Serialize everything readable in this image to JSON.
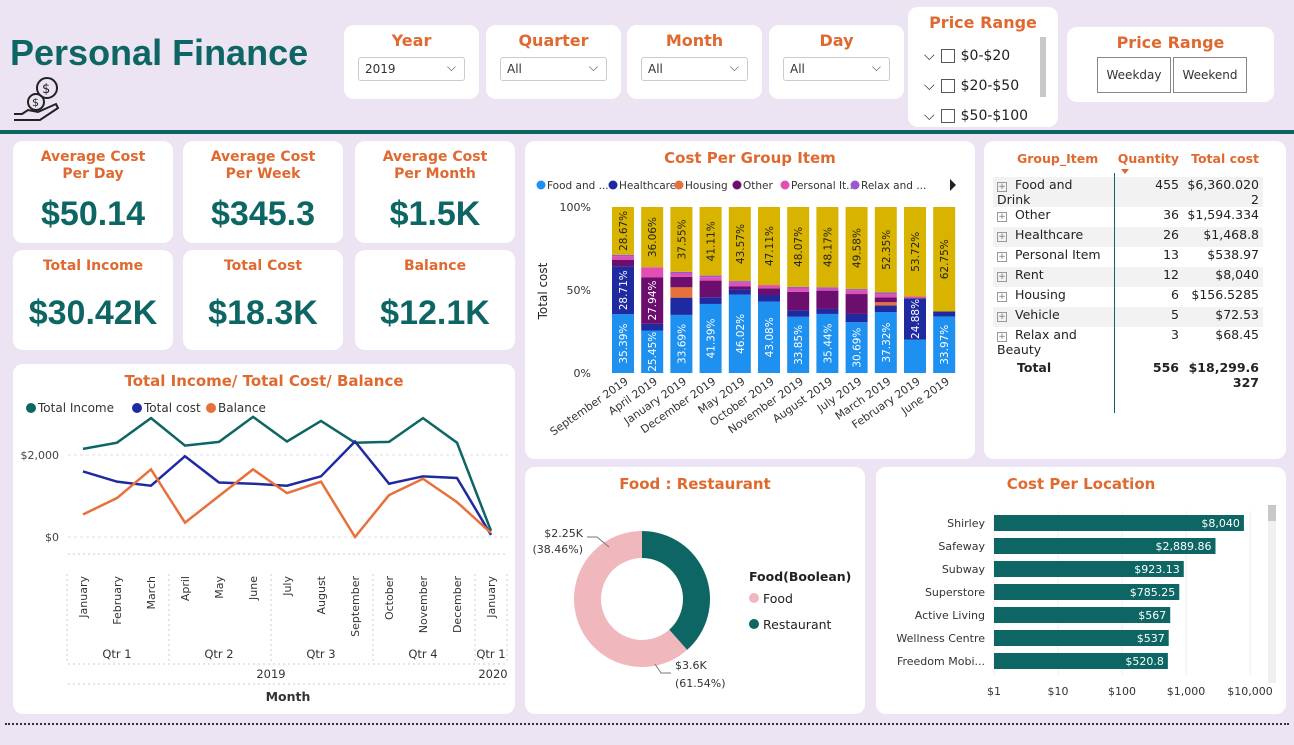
{
  "header": {
    "title": "Personal Finance"
  },
  "filters": {
    "year": {
      "label": "Year",
      "value": "2019"
    },
    "quarter": {
      "label": "Quarter",
      "value": "All"
    },
    "month": {
      "label": "Month",
      "value": "All"
    },
    "day": {
      "label": "Day",
      "value": "All"
    },
    "price_range_list": {
      "label": "Price Range",
      "items": [
        "$0-$20",
        "$20-$50",
        "$50-$100"
      ]
    },
    "price_range_buttons": {
      "label": "Price Range",
      "buttons": [
        "Weekday",
        "Weekend"
      ]
    }
  },
  "kpis": [
    {
      "label": "Average Cost Per Day",
      "value": "$50.14"
    },
    {
      "label": "Average Cost Per Week",
      "value": "$345.3"
    },
    {
      "label": "Average Cost Per Month",
      "value": "$1.5K"
    },
    {
      "label": "Total Income",
      "value": "$30.42K"
    },
    {
      "label": "Total Cost",
      "value": "$18.3K"
    },
    {
      "label": "Balance",
      "value": "$12.1K"
    }
  ],
  "colors": {
    "accent": "#e0692f",
    "brand": "#0d6664",
    "navy": "#1f2aa0",
    "food": "#f0b7bd",
    "blue": "#1e90f0",
    "yellow": "#d8b400",
    "purple": "#6b0e6e",
    "pink": "#e24fb4",
    "lilac": "#9b59d0"
  },
  "line_chart": {
    "title": "Total Income/ Total Cost/ Balance",
    "xlabel": "Month",
    "legend": [
      "Total Income",
      "Total cost",
      "Balance"
    ],
    "y_ticks": [
      "$2,000",
      "$0"
    ],
    "months": [
      "January",
      "February",
      "March",
      "April",
      "May",
      "June",
      "July",
      "August",
      "September",
      "October",
      "November",
      "December",
      "January"
    ],
    "quarters": [
      "Qtr 1",
      "Qtr 2",
      "Qtr 3",
      "Qtr 4",
      "Qtr 1"
    ],
    "years": [
      "2019",
      "2020"
    ]
  },
  "group_table": {
    "headers": [
      "Group_Item",
      "Quantity",
      "Total cost"
    ],
    "rows": [
      {
        "item": "Food and Drink",
        "qty": "455",
        "cost": "$6,360.0202"
      },
      {
        "item": "Other",
        "qty": "36",
        "cost": "$1,594.334"
      },
      {
        "item": "Healthcare",
        "qty": "26",
        "cost": "$1,468.8"
      },
      {
        "item": "Personal Item",
        "qty": "13",
        "cost": "$538.97"
      },
      {
        "item": "Rent",
        "qty": "12",
        "cost": "$8,040"
      },
      {
        "item": "Housing",
        "qty": "6",
        "cost": "$156.5285"
      },
      {
        "item": "Vehicle",
        "qty": "5",
        "cost": "$72.53"
      },
      {
        "item": "Relax and Beauty",
        "qty": "3",
        "cost": "$68.45"
      }
    ],
    "total": {
      "label": "Total",
      "qty": "556",
      "cost": "$18,299.6327"
    }
  },
  "donut_legend": {
    "title": "Food(Boolean)",
    "items": [
      "Food",
      "Restaurant"
    ]
  },
  "chart_data": [
    {
      "type": "line",
      "title": "Total Income/ Total Cost/ Balance",
      "x": [
        "January",
        "February",
        "March",
        "April",
        "May",
        "June",
        "July",
        "August",
        "September",
        "October",
        "November",
        "December",
        "January"
      ],
      "series": [
        {
          "name": "Total Income",
          "color": "#0d6664",
          "values": [
            2150,
            2300,
            2900,
            2230,
            2320,
            2930,
            2330,
            2830,
            2300,
            2320,
            2900,
            2300,
            150
          ]
        },
        {
          "name": "Total cost",
          "color": "#1f2aa0",
          "values": [
            1600,
            1350,
            1250,
            1970,
            1330,
            1300,
            1250,
            1480,
            2330,
            1300,
            1480,
            1440,
            50
          ]
        },
        {
          "name": "Balance",
          "color": "#e8703a",
          "values": [
            550,
            950,
            1650,
            350,
            1000,
            1650,
            1070,
            1350,
            0,
            1020,
            1420,
            850,
            100
          ]
        }
      ],
      "ylim": [
        0,
        3000
      ]
    },
    {
      "type": "bar",
      "stacked": true,
      "title": "Cost Per Group Item",
      "ylabel": "Total cost",
      "y_ticks": [
        "100%",
        "50%",
        "0%"
      ],
      "categories": [
        "September 2019",
        "April 2019",
        "January 2019",
        "December 2019",
        "May 2019",
        "October 2019",
        "November 2019",
        "August 2019",
        "July 2019",
        "March 2019",
        "February 2019",
        "June 2019"
      ],
      "legend": [
        "Food and ...",
        "Healthcare",
        "Housing",
        "Other",
        "Personal It...",
        "Relax and ..."
      ],
      "series": [
        {
          "name": "Food and ...",
          "color": "#1e90f0",
          "values": [
            35.39,
            25.45,
            33.69,
            41.39,
            46.02,
            43.08,
            33.85,
            35.44,
            30.69,
            37.32,
            20,
            33.97
          ],
          "labels": [
            "35.39%",
            "25.45%",
            "33.69%",
            "41.39%",
            "46.02%",
            "43.08%",
            "33.85%",
            "35.44%",
            "30.69%",
            "37.32%",
            "",
            "33.97%"
          ]
        },
        {
          "name": "Healthcare",
          "color": "#1f2aa0",
          "values": [
            28.71,
            4,
            10,
            4,
            3,
            4,
            4,
            3,
            5,
            4,
            24.88,
            3
          ],
          "labels": [
            "28.71%",
            "",
            "",
            "",
            "",
            "",
            "",
            "",
            "",
            "",
            "24.88%",
            ""
          ]
        },
        {
          "name": "Housing",
          "color": "#e8703a",
          "values": [
            0,
            0,
            6,
            0,
            0,
            0,
            0,
            0,
            0,
            2,
            0,
            0
          ],
          "labels": [
            "",
            "",
            "",
            "",
            "",
            "",
            "",
            "",
            "",
            "",
            "",
            ""
          ]
        },
        {
          "name": "Other",
          "color": "#6b0e6e",
          "values": [
            4,
            27.94,
            6,
            10,
            2,
            4,
            11,
            11,
            12,
            3,
            0,
            0
          ],
          "labels": [
            "",
            "27.94%",
            "",
            "",
            "",
            "",
            "",
            "",
            "",
            "",
            "",
            ""
          ]
        },
        {
          "name": "Personal It...",
          "color": "#e24fb4",
          "values": [
            2,
            6,
            2,
            2,
            2,
            2,
            2,
            1,
            2,
            2,
            1,
            0
          ],
          "labels": [
            "",
            "",
            "",
            "",
            "",
            "",
            "",
            "",
            "",
            "",
            "",
            ""
          ]
        },
        {
          "name": "Relax and ...",
          "color": "#9b59d0",
          "values": [
            1,
            0,
            1,
            1,
            1,
            0,
            1,
            1,
            1,
            1,
            0,
            0
          ],
          "labels": [
            "",
            "",
            "",
            "",
            "",
            "",
            "",
            "",
            "",
            "",
            "",
            ""
          ]
        },
        {
          "name": "Yellow",
          "color": "#d8b400",
          "values": [
            28.67,
            36.06,
            37.55,
            41.11,
            43.57,
            47.11,
            48.07,
            48.17,
            49.58,
            52.35,
            53.72,
            62.75
          ],
          "labels": [
            "28.67%",
            "36.06%",
            "37.55%",
            "41.11%",
            "43.57%",
            "47.11%",
            "48.07%",
            "48.17%",
            "49.58%",
            "52.35%",
            "53.72%",
            "62.75%"
          ]
        }
      ]
    },
    {
      "type": "pie",
      "title": "Food : Restaurant",
      "slices": [
        {
          "name": "Restaurant",
          "value": 2.25,
          "label": "$2.25K",
          "pct": "(38.46%)",
          "color": "#0d6664"
        },
        {
          "name": "Food",
          "value": 3.6,
          "label": "$3.6K",
          "pct": "(61.54%)",
          "color": "#f0b7bd"
        }
      ]
    },
    {
      "type": "bar",
      "orientation": "horizontal",
      "title": "Cost Per Location",
      "log_scale": true,
      "x_ticks": [
        "$1",
        "$10",
        "$100",
        "$1,000",
        "$10,000"
      ],
      "categories": [
        "Shirley",
        "Safeway",
        "Subway",
        "Superstore",
        "Active Living",
        "Wellness Centre",
        "Freedom Mobi..."
      ],
      "values": [
        8040,
        2889.86,
        923.13,
        785.25,
        567,
        537,
        520.8
      ],
      "labels": [
        "$8,040",
        "$2,889.86",
        "$923.13",
        "$785.25",
        "$567",
        "$537",
        "$520.8"
      ]
    }
  ]
}
